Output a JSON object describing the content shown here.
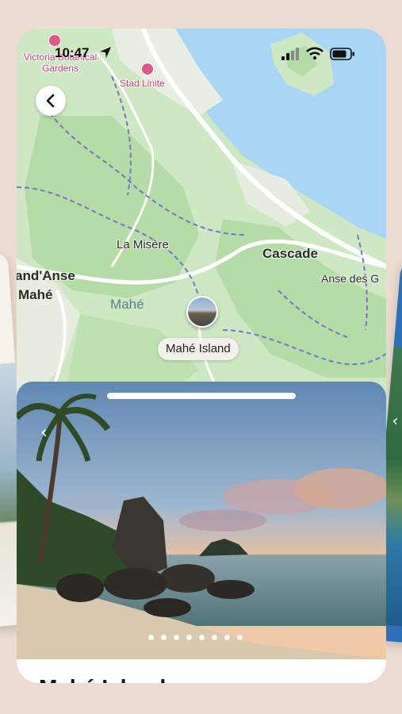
{
  "status_bar": {
    "time": "10:47"
  },
  "map": {
    "pois": [
      {
        "label": "Victoria Botanical\nGardens"
      },
      {
        "label": "Stad Linite"
      }
    ],
    "places": [
      {
        "label": "La Misère"
      },
      {
        "label": "Cascade"
      },
      {
        "label": "Anse des G"
      },
      {
        "label": "and'Anse"
      },
      {
        "label": "Mahé"
      }
    ],
    "region_label": "Mahé",
    "marker_label": "Mahé Island"
  },
  "photo_carousel": {
    "slide_count": 8,
    "active_index": 0
  },
  "detail": {
    "title": "Mahé Island"
  },
  "colors": {
    "water": "#a9d6f5",
    "land": "#cfe8c4",
    "forest": "#b5dba6",
    "road": "#ffffff",
    "trail": "#7a74c9",
    "poi": "#c2426f"
  }
}
